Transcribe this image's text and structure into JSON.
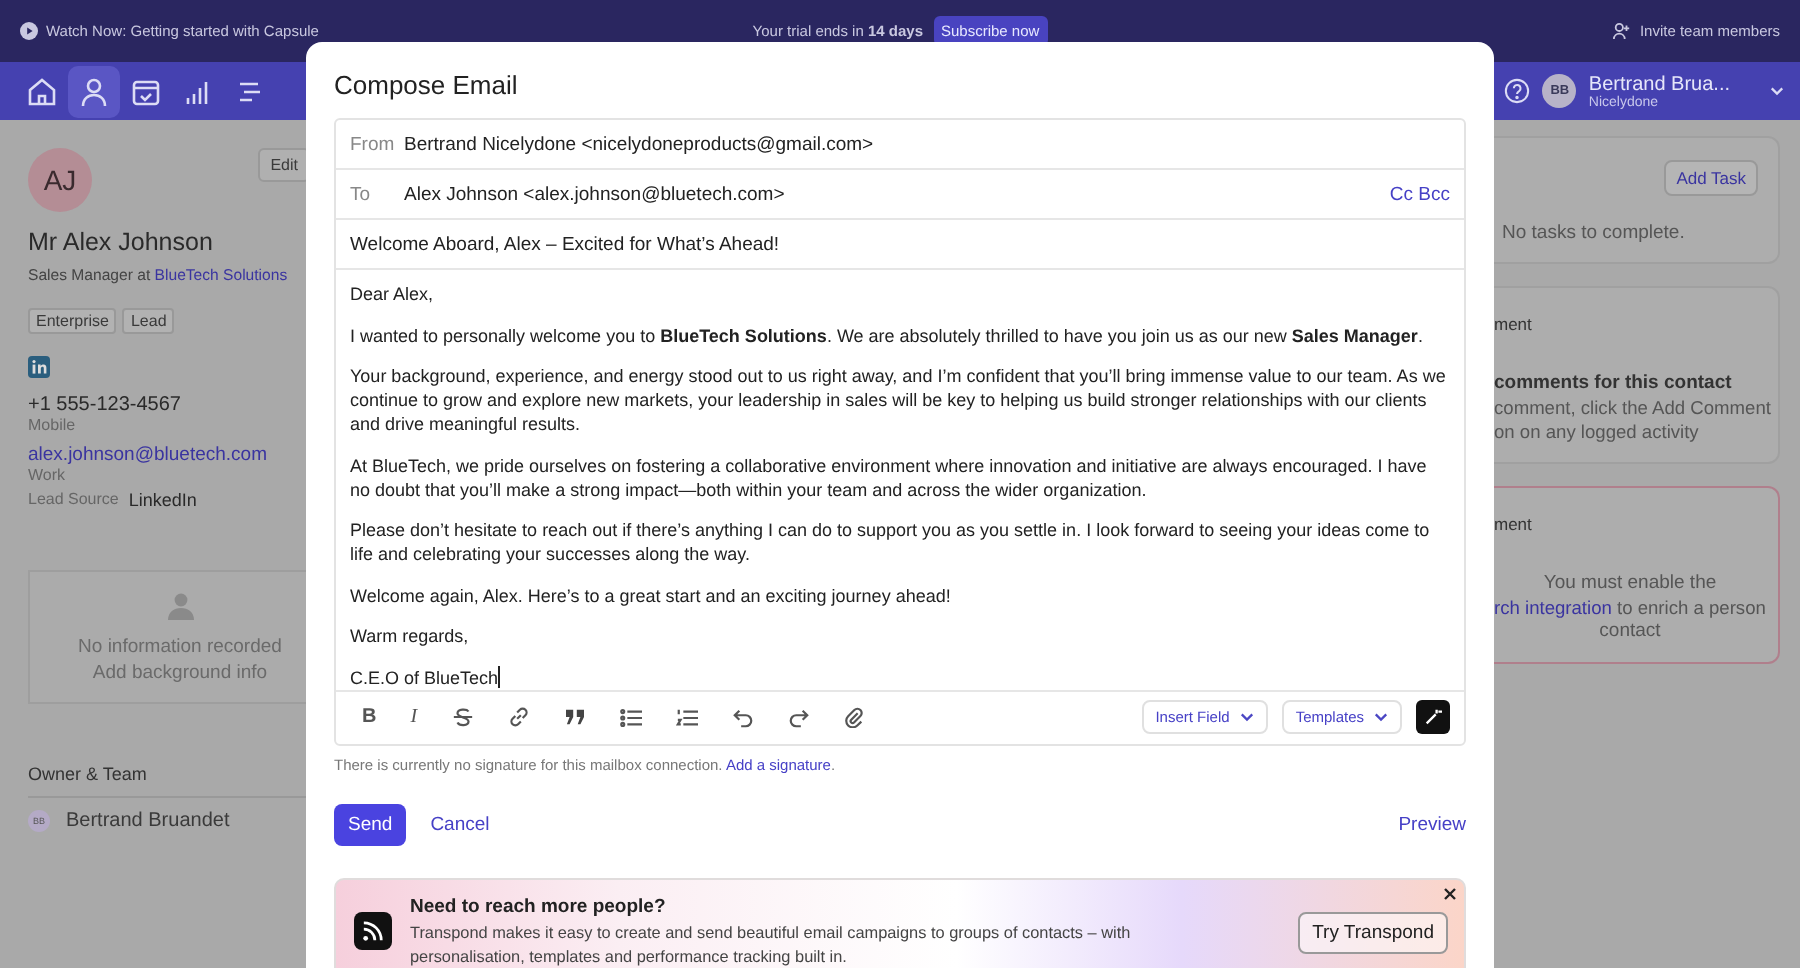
{
  "banner": {
    "watch_link": "Watch Now: Getting started with Capsule",
    "trial_text": "Your trial ends in **14 days**",
    "subscribe_button": "Subscribe now",
    "invite_link": "Invite team members"
  },
  "nav": {
    "items": [
      {
        "kind": "home",
        "selected": false
      },
      {
        "kind": "person",
        "selected": true
      },
      {
        "kind": "calendar",
        "selected": false
      },
      {
        "kind": "chart",
        "selected": false
      },
      {
        "kind": "list",
        "selected": false
      }
    ],
    "user": {
      "initials": "BB",
      "name": "Bertrand Brua...",
      "org": "Nicelydone"
    }
  },
  "contact": {
    "initials": "AJ",
    "edit_button": "Edit",
    "name": "Mr Alex Johnson",
    "role": "Sales Manager at",
    "company": "BlueTech Solutions",
    "tags": [
      "Enterprise",
      "Lead"
    ],
    "phone": "+1 555-123-4567",
    "phone_label": "Mobile",
    "email": "alex.johnson@bluetech.com",
    "email_label": "Work",
    "lead_source_label": "Lead Source",
    "lead_source": "LinkedIn",
    "background_lines": [
      "No information recorded",
      "Add background info"
    ],
    "owner_heading": "Owner & Team",
    "owner": {
      "initials": "BB",
      "name": "Bertrand Bruandet"
    }
  },
  "right_panel": {
    "add_task_button": "Add Task",
    "no_tasks": "No tasks to complete.",
    "comments_heading": "ment",
    "comments_title": "comments for this contact",
    "comments_lines": [
      "comment, click the Add Comment",
      "on on any logged activity"
    ],
    "enrich_heading": "ment",
    "enrich_line_1": "You must enable the",
    "enrich_link": "rch integration",
    "enrich_line_2_rest": " to enrich a person",
    "enrich_line_3": "contact"
  },
  "compose": {
    "title": "Compose Email",
    "from": {
      "label": "From",
      "value": "Bertrand Nicelydone <nicelydoneproducts@gmail.com>"
    },
    "to": {
      "label": "To",
      "value": "Alex Johnson <alex.johnson@bluetech.com>",
      "cc_bcc": "Cc Bcc"
    },
    "subject": "Welcome Aboard, Alex – Excited for What’s Ahead!",
    "body": [
      "Dear Alex,",
      "I wanted to personally welcome you to **BlueTech Solutions**. We are absolutely thrilled to have you join us as our new **Sales Manager**.",
      "Your background, experience, and energy stood out to us right away, and I’m confident that you’ll bring immense value to our team. As we continue to grow and explore new markets, your leadership in sales will be key to helping us build stronger relationships with our clients and drive meaningful results.",
      "At BlueTech, we pride ourselves on fostering a collaborative environment where innovation and initiative are always encouraged. I have no doubt that you’ll make a strong impact—both within your team and across the wider organization.",
      "Please don’t hesitate to reach out if there’s anything I can do to support you as you settle in. I look forward to seeing your ideas come to life and celebrating your successes along the way.",
      "Welcome again, Alex. Here’s to a great start and an exciting journey ahead!",
      "Warm regards,",
      "C.E.O of BlueTech"
    ],
    "tools": [
      {
        "kind": "bold",
        "glyph": "B"
      },
      {
        "kind": "italic",
        "glyph": "I"
      },
      {
        "kind": "strike"
      },
      {
        "kind": "link"
      },
      {
        "kind": "quote"
      },
      {
        "kind": "bullets"
      },
      {
        "kind": "numbers"
      },
      {
        "kind": "undo"
      },
      {
        "kind": "redo"
      },
      {
        "kind": "attach"
      }
    ],
    "insert_field": "Insert Field",
    "templates": "Templates",
    "signature": {
      "text": "There is currently no signature for this mailbox connection.",
      "link": "Add a signature",
      "after": "."
    },
    "send_button": "Send",
    "cancel_button": "Cancel",
    "preview_link": "Preview",
    "promo": {
      "title": "Need to reach more people?",
      "text": "Transpond makes it easy to create and send beautiful email campaigns to groups of contacts – with personalisation, templates and performance tracking built in.",
      "button": "Try Transpond"
    }
  }
}
